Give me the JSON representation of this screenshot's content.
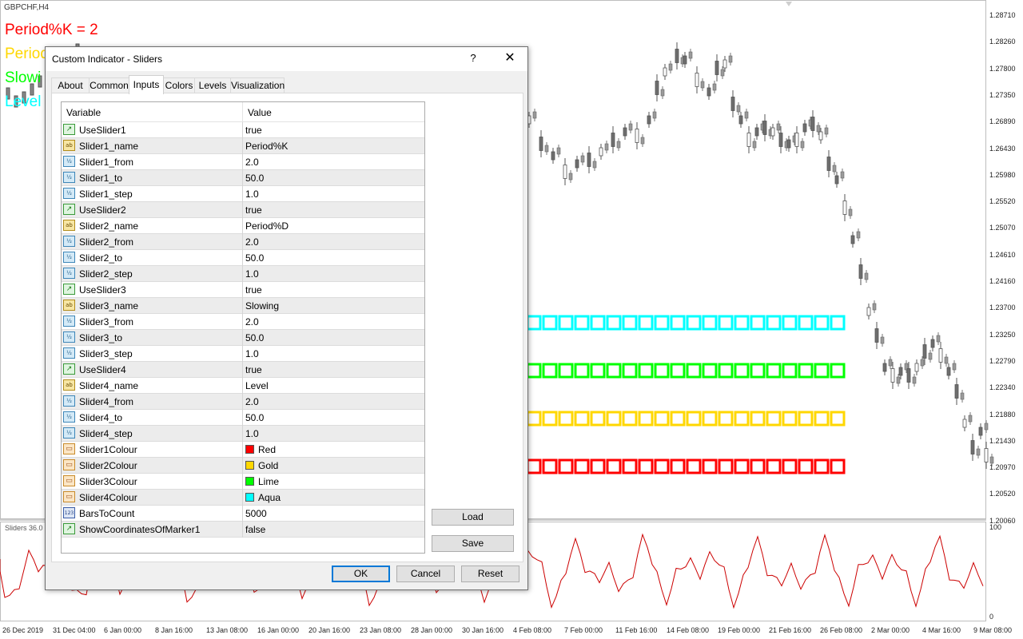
{
  "chart": {
    "symbol": "GBPCHF,H4",
    "slider_labels": [
      {
        "text": "Period%K = 2",
        "color": "#ff0000"
      },
      {
        "text": "Period",
        "color": "#ffd700"
      },
      {
        "text": "Slowi",
        "color": "#00ff00"
      },
      {
        "text": "Level",
        "color": "#00ffff"
      }
    ],
    "price_labels": [
      "1.28710",
      "1.28260",
      "1.27800",
      "1.27350",
      "1.26890",
      "1.26430",
      "1.25980",
      "1.25520",
      "1.25070",
      "1.24610",
      "1.24160",
      "1.23700",
      "1.23250",
      "1.22790",
      "1.22340",
      "1.21880",
      "1.21430",
      "1.20970",
      "1.20520",
      "1.20060"
    ],
    "date_labels": [
      "26 Dec 2019",
      "31 Dec 04:00",
      "6 Jan 00:00",
      "8 Jan 16:00",
      "13 Jan 08:00",
      "16 Jan 00:00",
      "20 Jan 16:00",
      "23 Jan 08:00",
      "28 Jan 00:00",
      "30 Jan 16:00",
      "4 Feb 08:00",
      "7 Feb 00:00",
      "11 Feb 16:00",
      "14 Feb 08:00",
      "19 Feb 00:00",
      "21 Feb 16:00",
      "26 Feb 08:00",
      "2 Mar 00:00",
      "4 Mar 16:00",
      "9 Mar 08:00"
    ],
    "subwindow_title": "Sliders 36.0",
    "subwindow_levels": {
      "top": "100",
      "bottom": "0"
    },
    "slider_rows_colors": [
      "#00ffff",
      "#00ff00",
      "#ffd700",
      "#ff0000"
    ]
  },
  "dialog": {
    "title": "Custom Indicator - Sliders",
    "help_label": "?",
    "close_label": "✕",
    "tabs": [
      "About",
      "Common",
      "Inputs",
      "Colors",
      "Levels",
      "Visualization"
    ],
    "active_tab": "Inputs",
    "columns": {
      "variable": "Variable",
      "value": "Value"
    },
    "rows": [
      {
        "type": "bool",
        "icon": "↗",
        "name": "UseSlider1",
        "value": "true"
      },
      {
        "type": "str",
        "icon": "ab",
        "name": "Slider1_name",
        "value": "Period%K"
      },
      {
        "type": "dbl",
        "icon": "½",
        "name": "Slider1_from",
        "value": "2.0"
      },
      {
        "type": "dbl",
        "icon": "½",
        "name": "Slider1_to",
        "value": "50.0"
      },
      {
        "type": "dbl",
        "icon": "½",
        "name": "Slider1_step",
        "value": "1.0"
      },
      {
        "type": "bool",
        "icon": "↗",
        "name": "UseSlider2",
        "value": "true"
      },
      {
        "type": "str",
        "icon": "ab",
        "name": "Slider2_name",
        "value": "Period%D"
      },
      {
        "type": "dbl",
        "icon": "½",
        "name": "Slider2_from",
        "value": "2.0"
      },
      {
        "type": "dbl",
        "icon": "½",
        "name": "Slider2_to",
        "value": "50.0"
      },
      {
        "type": "dbl",
        "icon": "½",
        "name": "Slider2_step",
        "value": "1.0"
      },
      {
        "type": "bool",
        "icon": "↗",
        "name": "UseSlider3",
        "value": "true"
      },
      {
        "type": "str",
        "icon": "ab",
        "name": "Slider3_name",
        "value": "Slowing"
      },
      {
        "type": "dbl",
        "icon": "½",
        "name": "Slider3_from",
        "value": "2.0"
      },
      {
        "type": "dbl",
        "icon": "½",
        "name": "Slider3_to",
        "value": "50.0"
      },
      {
        "type": "dbl",
        "icon": "½",
        "name": "Slider3_step",
        "value": "1.0"
      },
      {
        "type": "bool",
        "icon": "↗",
        "name": "UseSlider4",
        "value": "true"
      },
      {
        "type": "str",
        "icon": "ab",
        "name": "Slider4_name",
        "value": "Level"
      },
      {
        "type": "dbl",
        "icon": "½",
        "name": "Slider4_from",
        "value": "2.0"
      },
      {
        "type": "dbl",
        "icon": "½",
        "name": "Slider4_to",
        "value": "50.0"
      },
      {
        "type": "dbl",
        "icon": "½",
        "name": "Slider4_step",
        "value": "1.0"
      },
      {
        "type": "col",
        "icon": "▭",
        "name": "Slider1Colour",
        "value": "Red",
        "swatch": "#ff0000"
      },
      {
        "type": "col",
        "icon": "▭",
        "name": "Slider2Colour",
        "value": "Gold",
        "swatch": "#ffd700"
      },
      {
        "type": "col",
        "icon": "▭",
        "name": "Slider3Colour",
        "value": "Lime",
        "swatch": "#00ff00"
      },
      {
        "type": "col",
        "icon": "▭",
        "name": "Slider4Colour",
        "value": "Aqua",
        "swatch": "#00ffff"
      },
      {
        "type": "int",
        "icon": "123",
        "name": "BarsToCount",
        "value": "5000"
      },
      {
        "type": "bool",
        "icon": "↗",
        "name": "ShowCoordinatesOfMarker1",
        "value": "false"
      }
    ],
    "buttons": {
      "load": "Load",
      "save": "Save",
      "ok": "OK",
      "cancel": "Cancel",
      "reset": "Reset"
    }
  }
}
